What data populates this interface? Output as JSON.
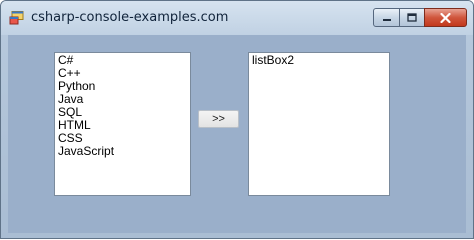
{
  "window": {
    "title": "csharp-console-examples.com"
  },
  "left_listbox": {
    "items": [
      "C#",
      "C++",
      "Python",
      "Java",
      "SQL",
      "HTML",
      "CSS",
      "JavaScript"
    ]
  },
  "right_listbox": {
    "items": [
      "listBox2"
    ]
  },
  "move_button": {
    "label": ">>"
  },
  "icons": {
    "app": "app-window-icon",
    "minimize": "minimize-icon",
    "maximize": "maximize-icon",
    "close": "close-icon"
  },
  "colors": {
    "client_background": "#9aafca",
    "close_button": "#c2381c"
  }
}
